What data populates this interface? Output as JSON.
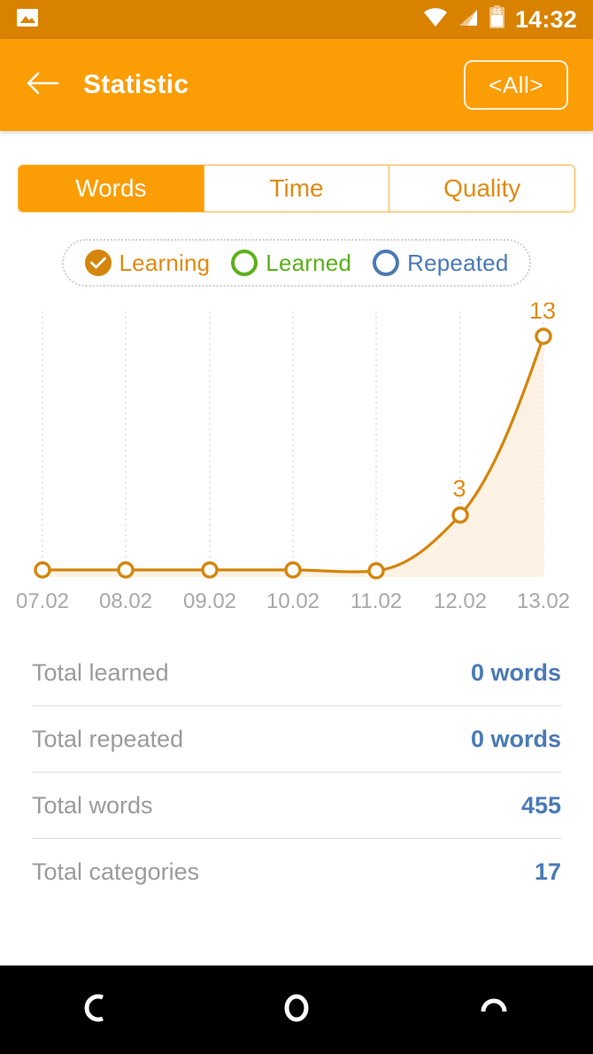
{
  "status_bar": {
    "icons": [
      "image-icon",
      "wifi-icon",
      "cell-signal-icon",
      "battery-icon"
    ],
    "battery_level": "66",
    "time": "14:32"
  },
  "app_bar": {
    "back_icon": "back-arrow-icon",
    "title": "Statistic",
    "filter_label": "<All>"
  },
  "tabs": [
    {
      "label": "Words",
      "active": true
    },
    {
      "label": "Time",
      "active": false
    },
    {
      "label": "Quality",
      "active": false
    }
  ],
  "legend": [
    {
      "label": "Learning",
      "color": "#e08b12",
      "marker_color": "#d4850c",
      "selected": true,
      "icon": "check-icon"
    },
    {
      "label": "Learned",
      "color": "#5cb01a",
      "marker_color": "#5cb01a",
      "selected": false,
      "icon": "circle-outline-icon"
    },
    {
      "label": "Repeated",
      "color": "#4a7ab5",
      "marker_color": "#4a7ab5",
      "selected": false,
      "icon": "circle-outline-icon"
    }
  ],
  "chart_data": {
    "type": "line",
    "title": "",
    "xlabel": "",
    "ylabel": "",
    "categories": [
      "07.02",
      "08.02",
      "09.02",
      "10.02",
      "11.02",
      "12.02",
      "13.02"
    ],
    "series": [
      {
        "name": "Learning",
        "values": [
          0,
          0,
          0,
          0,
          0,
          3,
          13
        ],
        "color": "#d4850c",
        "fill_color": "#fdf2e4"
      }
    ],
    "point_labels": [
      "",
      "",
      "",
      "",
      "",
      "3",
      "13"
    ],
    "ylim": [
      0,
      13
    ],
    "grid": "vertical-dotted",
    "legend_position": "top",
    "smooth": true
  },
  "stats": [
    {
      "label": "Total learned",
      "value": "0 words"
    },
    {
      "label": "Total repeated",
      "value": "0 words"
    },
    {
      "label": "Total words",
      "value": "455"
    },
    {
      "label": "Total categories",
      "value": "17"
    }
  ],
  "nav_bar": {
    "back_icon": "nav-back-icon",
    "home_icon": "nav-home-icon",
    "recents_icon": "nav-recents-icon"
  },
  "colors": {
    "status_bar": "#d98200",
    "app_bar": "#fb9d05",
    "accent": "#fb9d05",
    "chart_line": "#d4850c",
    "chart_fill": "#fdf2e4",
    "value_blue": "#4a7ab5",
    "label_gray": "#9b9b9b"
  }
}
